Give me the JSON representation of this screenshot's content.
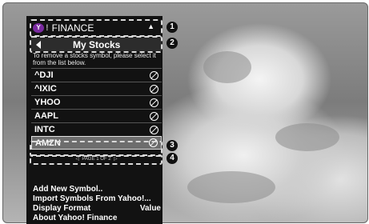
{
  "header": {
    "title": "FINANCE",
    "logo_letter": "Y",
    "logo_mark": "!",
    "home_glyph": "▲"
  },
  "subheader": {
    "title": "My Stocks"
  },
  "instructions": "To remove a stocks symbol, please select it from the list below.",
  "stocks": [
    "^DJI",
    "^IXIC",
    "YHOO",
    "AAPL",
    "INTC",
    "AMZN"
  ],
  "selected_stock": "AMZN",
  "pager": {
    "label": "PAGE 1 OF 2"
  },
  "menu": {
    "add": "Add New Symbol..",
    "import": "Import Symbols From Yahoo!...",
    "display_format": "Display Format",
    "display_value": "Value",
    "about": "About Yahoo! Finance"
  },
  "callouts": [
    "1",
    "2",
    "3",
    "4"
  ],
  "colors": {
    "panel": "#121212",
    "selected_row": "#6d6d6d",
    "logo": "#7a2aa0"
  }
}
